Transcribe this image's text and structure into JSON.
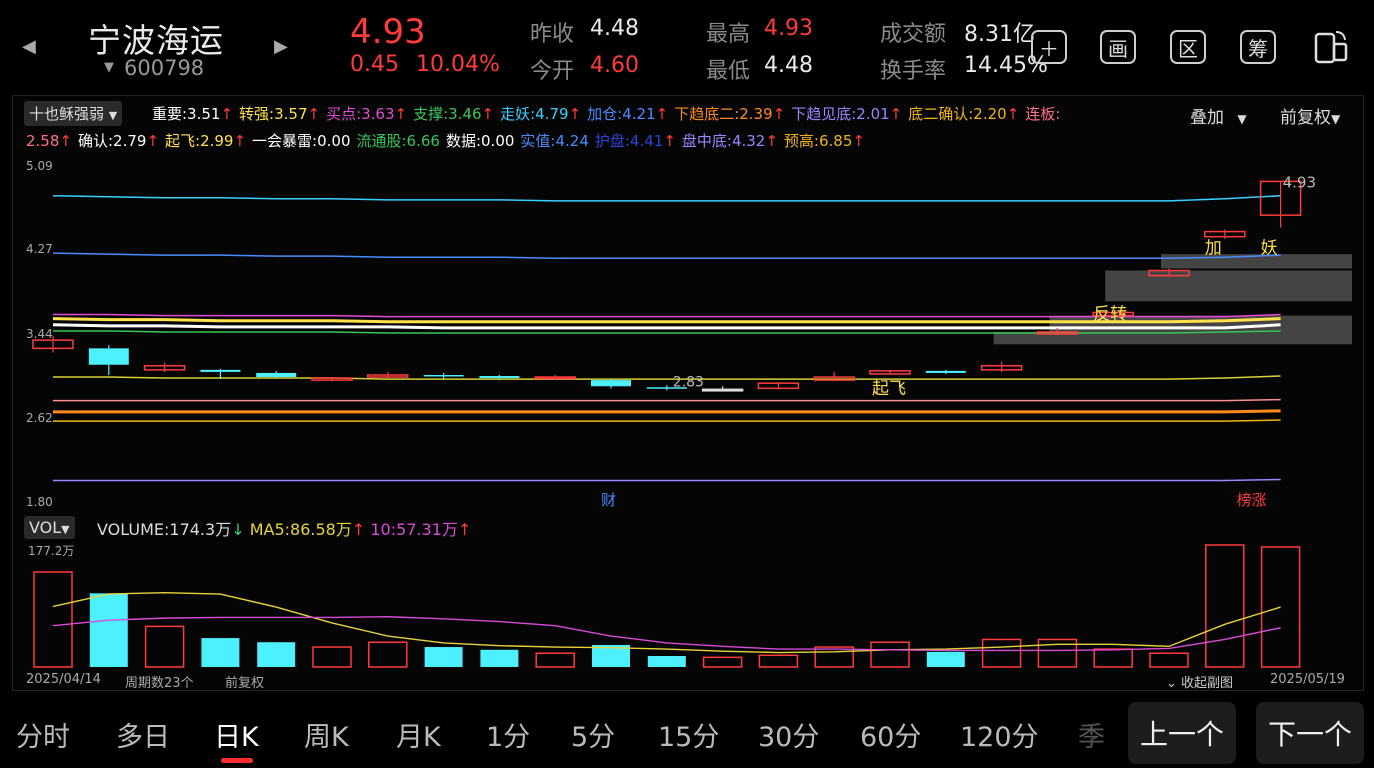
{
  "header": {
    "name": "宁波海运",
    "code": "600798",
    "price": "4.93",
    "change": "0.45",
    "change_pct": "10.04%",
    "quotes": [
      {
        "label": "昨收",
        "value": "4.48"
      },
      {
        "label": "今开",
        "value": "4.60"
      },
      {
        "label": "最高",
        "value": "4.93"
      },
      {
        "label": "最低",
        "value": "4.48"
      },
      {
        "label": "成交额",
        "value": "8.31亿"
      },
      {
        "label": "换手率",
        "value": "14.45%"
      }
    ],
    "icons": [
      "plus-icon",
      "画",
      "区",
      "筹",
      "rotate-icon"
    ],
    "icon_labels": [
      "画",
      "区",
      "筹"
    ]
  },
  "indicator": {
    "selector": "十也稣强弱",
    "overlay": "叠加",
    "adjust": "前复权",
    "row1": [
      {
        "text": "重要:3.51",
        "color": "#ffffff",
        "arrow": "↑"
      },
      {
        "text": "转强:3.57",
        "color": "#ffe14a",
        "arrow": "↑"
      },
      {
        "text": "买点:3.63",
        "color": "#e24bd8",
        "arrow": "↑"
      },
      {
        "text": "支撑:3.46",
        "color": "#39c55a",
        "arrow": "↑"
      },
      {
        "text": "走妖:4.79",
        "color": "#3ad0ff",
        "arrow": "↑"
      },
      {
        "text": "加仓:4.21",
        "color": "#4a8cff",
        "arrow": "↑"
      },
      {
        "text": "下趋底二:2.39",
        "color": "#ff8a1c",
        "arrow": "↑"
      },
      {
        "text": "下趋见底:2.01",
        "color": "#9a86ff",
        "arrow": "↑"
      },
      {
        "text": "底二确认:2.20",
        "color": "#f0b419",
        "arrow": "↑"
      },
      {
        "text": "连板:",
        "color": "#ff6f8a",
        "arrow": ""
      }
    ],
    "row2": [
      {
        "text": "2.58",
        "color": "#ff6f8a",
        "arrow": "↑"
      },
      {
        "text": "确认:2.79",
        "color": "#ffffff",
        "arrow": "↑"
      },
      {
        "text": "起飞:2.99",
        "color": "#ffe14a",
        "arrow": "↑"
      },
      {
        "text": "一会暴雷:0.00",
        "color": "#ffffff",
        "arrow": ""
      },
      {
        "text": "流通股:6.66",
        "color": "#39c55a",
        "arrow": ""
      },
      {
        "text": "数据:0.00",
        "color": "#ffffff",
        "arrow": ""
      },
      {
        "text": "实值:4.24",
        "color": "#4a8cff",
        "arrow": ""
      },
      {
        "text": "护盘:4.41",
        "color": "#2d43d8",
        "arrow": "↑"
      },
      {
        "text": "盘中底:4.32",
        "color": "#9a86ff",
        "arrow": "↑"
      },
      {
        "text": "预高:6.85",
        "color": "#f0b419",
        "arrow": "↑"
      }
    ]
  },
  "colors": {
    "up": "#ff3b3b",
    "down": "#4df0ff",
    "bg": "#000000"
  },
  "chart_data": {
    "type": "candlestick",
    "y_ticks": [
      "5.09",
      "4.27",
      "3.44",
      "2.62",
      "1.80"
    ],
    "ylim": [
      1.8,
      5.09
    ],
    "candles": [
      {
        "o": 3.3,
        "c": 3.38,
        "h": 3.42,
        "l": 3.26,
        "dir": "up"
      },
      {
        "o": 3.3,
        "c": 3.14,
        "h": 3.33,
        "l": 3.04,
        "dir": "down"
      },
      {
        "o": 3.09,
        "c": 3.13,
        "h": 3.16,
        "l": 3.07,
        "dir": "up"
      },
      {
        "o": 3.09,
        "c": 3.07,
        "h": 3.1,
        "l": 3.0,
        "dir": "down"
      },
      {
        "o": 3.06,
        "c": 3.02,
        "h": 3.08,
        "l": 3.01,
        "dir": "down"
      },
      {
        "o": 3.01,
        "c": 2.99,
        "h": 3.02,
        "l": 2.98,
        "dir": "up"
      },
      {
        "o": 3.02,
        "c": 3.04,
        "h": 3.07,
        "l": 3.01,
        "dir": "up"
      },
      {
        "o": 3.04,
        "c": 3.03,
        "h": 3.06,
        "l": 3.0,
        "dir": "down"
      },
      {
        "o": 3.03,
        "c": 3.01,
        "h": 3.04,
        "l": 2.99,
        "dir": "down"
      },
      {
        "o": 3.01,
        "c": 3.02,
        "h": 3.04,
        "l": 2.99,
        "dir": "up"
      },
      {
        "o": 2.99,
        "c": 2.93,
        "h": 3.0,
        "l": 2.91,
        "dir": "down"
      },
      {
        "o": 2.92,
        "c": 2.91,
        "h": 2.94,
        "l": 2.89,
        "dir": "down"
      },
      {
        "o": 2.9,
        "c": 2.9,
        "h": 2.93,
        "l": 2.88,
        "dir": "flat"
      },
      {
        "o": 2.91,
        "c": 2.96,
        "h": 2.97,
        "l": 2.9,
        "dir": "up"
      },
      {
        "o": 2.99,
        "c": 3.02,
        "h": 3.07,
        "l": 2.98,
        "dir": "up"
      },
      {
        "o": 3.05,
        "c": 3.08,
        "h": 3.09,
        "l": 3.04,
        "dir": "up"
      },
      {
        "o": 3.08,
        "c": 3.06,
        "h": 3.09,
        "l": 3.05,
        "dir": "down"
      },
      {
        "o": 3.09,
        "c": 3.13,
        "h": 3.17,
        "l": 3.07,
        "dir": "up"
      },
      {
        "o": 3.44,
        "c": 3.46,
        "h": 3.5,
        "l": 3.43,
        "dir": "up"
      },
      {
        "o": 3.62,
        "c": 3.65,
        "h": 3.67,
        "l": 3.6,
        "dir": "up"
      },
      {
        "o": 4.01,
        "c": 4.06,
        "h": 4.08,
        "l": 4.0,
        "dir": "up"
      },
      {
        "o": 4.39,
        "c": 4.44,
        "h": 4.46,
        "l": 4.37,
        "dir": "up"
      },
      {
        "o": 4.6,
        "c": 4.93,
        "h": 4.93,
        "l": 4.48,
        "dir": "up"
      }
    ],
    "annotations": {
      "high_label": "4.93",
      "low_label": "2.83",
      "signal_qifei": "起飞",
      "signal_fanzhuan": "反转",
      "signal_jia": "加",
      "signal_yao": "妖",
      "signal_cai": "财",
      "signal_bangzhang": "榜涨"
    },
    "lines": [
      {
        "name": "走妖",
        "color": "#3ad0ff",
        "values": [
          4.79,
          4.78,
          4.77,
          4.77,
          4.76,
          4.76,
          4.75,
          4.75,
          4.75,
          4.74,
          4.74,
          4.74,
          4.74,
          4.74,
          4.74,
          4.74,
          4.74,
          4.74,
          4.74,
          4.74,
          4.74,
          4.76,
          4.79
        ]
      },
      {
        "name": "加仓",
        "color": "#4a8cff",
        "values": [
          4.23,
          4.22,
          4.21,
          4.21,
          4.2,
          4.2,
          4.19,
          4.19,
          4.19,
          4.18,
          4.18,
          4.18,
          4.18,
          4.18,
          4.18,
          4.18,
          4.18,
          4.18,
          4.18,
          4.18,
          4.18,
          4.19,
          4.21
        ]
      },
      {
        "name": "买点",
        "color": "#e24bd8",
        "values": [
          3.63,
          3.63,
          3.62,
          3.62,
          3.62,
          3.62,
          3.61,
          3.61,
          3.61,
          3.61,
          3.61,
          3.61,
          3.61,
          3.61,
          3.61,
          3.61,
          3.61,
          3.61,
          3.61,
          3.61,
          3.61,
          3.61,
          3.63
        ]
      },
      {
        "name": "转强",
        "color": "#ffe14a",
        "values": [
          3.59,
          3.58,
          3.58,
          3.57,
          3.57,
          3.57,
          3.56,
          3.56,
          3.56,
          3.56,
          3.56,
          3.56,
          3.56,
          3.56,
          3.56,
          3.56,
          3.56,
          3.56,
          3.56,
          3.56,
          3.56,
          3.57,
          3.59
        ]
      },
      {
        "name": "重要",
        "color": "#ffffff",
        "values": [
          3.53,
          3.52,
          3.52,
          3.51,
          3.51,
          3.51,
          3.51,
          3.5,
          3.5,
          3.5,
          3.5,
          3.5,
          3.5,
          3.5,
          3.5,
          3.5,
          3.5,
          3.5,
          3.5,
          3.5,
          3.5,
          3.5,
          3.53
        ]
      },
      {
        "name": "支撑",
        "color": "#39c55a",
        "values": [
          3.47,
          3.47,
          3.46,
          3.46,
          3.46,
          3.46,
          3.45,
          3.45,
          3.45,
          3.45,
          3.45,
          3.45,
          3.45,
          3.45,
          3.45,
          3.45,
          3.45,
          3.45,
          3.45,
          3.45,
          3.45,
          3.46,
          3.47
        ]
      },
      {
        "name": "起飞",
        "color": "#d7d23a",
        "values": [
          3.02,
          3.02,
          3.01,
          3.01,
          3.01,
          3.01,
          3.0,
          3.0,
          3.0,
          3.0,
          3.0,
          3.0,
          3.0,
          3.0,
          3.0,
          3.0,
          3.0,
          3.0,
          3.0,
          3.0,
          3.0,
          3.01,
          3.03
        ]
      },
      {
        "name": "确认",
        "color": "#ff9090",
        "values": [
          2.79,
          2.79,
          2.79,
          2.79,
          2.79,
          2.79,
          2.79,
          2.79,
          2.79,
          2.79,
          2.79,
          2.79,
          2.79,
          2.79,
          2.79,
          2.79,
          2.79,
          2.79,
          2.79,
          2.79,
          2.79,
          2.79,
          2.8
        ]
      },
      {
        "name": "下趋底二",
        "color": "#ff8a1c",
        "values": [
          2.68,
          2.68,
          2.68,
          2.68,
          2.68,
          2.68,
          2.68,
          2.68,
          2.68,
          2.68,
          2.68,
          2.68,
          2.68,
          2.68,
          2.68,
          2.68,
          2.68,
          2.68,
          2.68,
          2.68,
          2.68,
          2.68,
          2.69
        ]
      },
      {
        "name": "底二确认",
        "color": "#f0b419",
        "values": [
          2.59,
          2.59,
          2.59,
          2.59,
          2.59,
          2.59,
          2.59,
          2.59,
          2.59,
          2.59,
          2.59,
          2.59,
          2.59,
          2.59,
          2.59,
          2.59,
          2.59,
          2.59,
          2.59,
          2.59,
          2.59,
          2.59,
          2.6
        ]
      },
      {
        "name": "下趋见底",
        "color": "#9a86ff",
        "values": [
          2.01,
          2.01,
          2.01,
          2.01,
          2.01,
          2.01,
          2.01,
          2.01,
          2.01,
          2.01,
          2.01,
          2.01,
          2.01,
          2.01,
          2.01,
          2.01,
          2.01,
          2.01,
          2.01,
          2.01,
          2.01,
          2.01,
          2.02
        ]
      }
    ],
    "zones": [
      {
        "from_index": 17,
        "low": 3.34,
        "high": 3.46
      },
      {
        "from_index": 18,
        "low": 3.46,
        "high": 3.62
      },
      {
        "from_index": 19,
        "low": 3.76,
        "high": 4.06
      },
      {
        "from_index": 20,
        "low": 4.08,
        "high": 4.22
      }
    ]
  },
  "volume": {
    "selector": "VOL",
    "volume_label": "VOLUME:174.3万",
    "ma5_label": "MA5:86.58万",
    "ma10_label": "10:57.31万",
    "max_label": "177.2万",
    "ymax": 177.2,
    "bars": [
      {
        "v": 138,
        "dir": "up"
      },
      {
        "v": 107,
        "dir": "down"
      },
      {
        "v": 59,
        "dir": "up"
      },
      {
        "v": 42,
        "dir": "down"
      },
      {
        "v": 36,
        "dir": "down"
      },
      {
        "v": 29,
        "dir": "up"
      },
      {
        "v": 36,
        "dir": "up"
      },
      {
        "v": 29,
        "dir": "down"
      },
      {
        "v": 25,
        "dir": "down"
      },
      {
        "v": 20,
        "dir": "up"
      },
      {
        "v": 32,
        "dir": "down"
      },
      {
        "v": 16,
        "dir": "down"
      },
      {
        "v": 14,
        "dir": "up"
      },
      {
        "v": 17,
        "dir": "up"
      },
      {
        "v": 29,
        "dir": "up"
      },
      {
        "v": 36,
        "dir": "up"
      },
      {
        "v": 22,
        "dir": "down"
      },
      {
        "v": 40,
        "dir": "up"
      },
      {
        "v": 40,
        "dir": "up"
      },
      {
        "v": 26,
        "dir": "up"
      },
      {
        "v": 20,
        "dir": "up"
      },
      {
        "v": 177.2,
        "dir": "up"
      },
      {
        "v": 174.3,
        "dir": "up"
      }
    ],
    "ma5": [
      88,
      106,
      108,
      106,
      87,
      64,
      45,
      35,
      31,
      29,
      28,
      26,
      23,
      21,
      22,
      25,
      26,
      29,
      33,
      33,
      30,
      62,
      87
    ],
    "ma10": [
      60,
      68,
      71,
      72,
      72,
      72,
      73,
      70,
      66,
      60,
      45,
      35,
      30,
      26,
      26,
      25,
      24,
      24,
      24,
      25,
      27,
      40,
      57
    ]
  },
  "footer": {
    "start_date": "2025/04/14",
    "period_count": "周期数23个",
    "adjust": "前复权",
    "collapse": "收起副图",
    "end_date": "2025/05/19"
  },
  "bottom_tabs": [
    "分时",
    "多日",
    "日K",
    "周K",
    "月K",
    "1分",
    "5分",
    "15分",
    "30分",
    "60分",
    "120分",
    "季"
  ],
  "nav": {
    "prev": "上一个",
    "next": "下一个"
  }
}
